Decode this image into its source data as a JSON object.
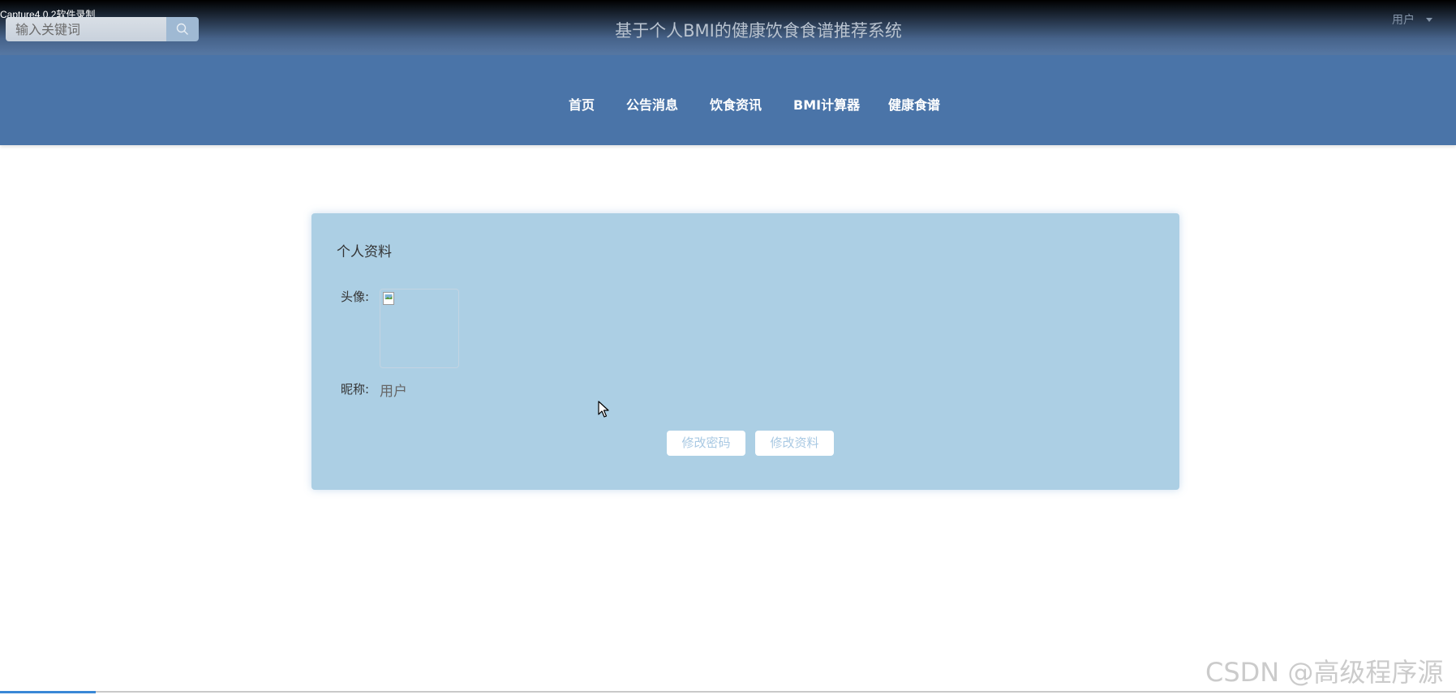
{
  "capture_tag": "Capture4.0.2软件录制",
  "header": {
    "search_placeholder": "输入关键词",
    "site_title": "基于个人BMI的健康饮食食谱推荐系统",
    "user_label": "用户"
  },
  "nav": {
    "items": [
      {
        "label": "首页"
      },
      {
        "label": "公告消息"
      },
      {
        "label": "饮食资讯"
      },
      {
        "label": "BMI计算器"
      },
      {
        "label": "健康食谱"
      }
    ]
  },
  "profile": {
    "title": "个人资料",
    "avatar_label": "头像:",
    "nickname_label": "昵称:",
    "nickname_value": "用户",
    "change_password_label": "修改密码",
    "edit_profile_label": "修改资料"
  },
  "watermark": "CSDN @高级程序源",
  "colors": {
    "nav_bg": "#4a74a8",
    "card_bg": "#accfe4",
    "button_text": "#a9c9e3"
  }
}
